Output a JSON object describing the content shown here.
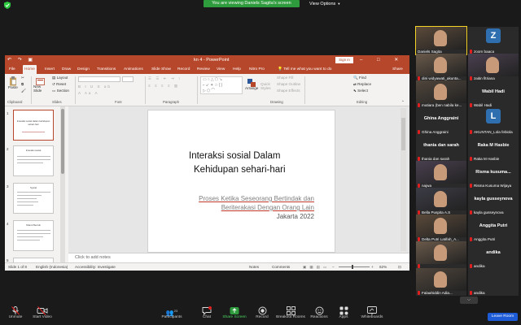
{
  "banner": {
    "viewing_text": "You are viewing Daniels Sagita's screen",
    "view_options": "View Options"
  },
  "powerpoint": {
    "file_title": "kn 4  -  PowerPoint",
    "sign_in": "Sign in",
    "quick_access": "↶ ↷ ▣",
    "window_controls": "– □ ✕",
    "tabs": [
      "File",
      "Home",
      "Insert",
      "Draw",
      "Design",
      "Transitions",
      "Animations",
      "Slide Show",
      "Record",
      "Review",
      "View",
      "Help",
      "Nitro Pro"
    ],
    "tell_me": "Tell me what you want to do",
    "share": "Share",
    "ribbon": {
      "paste": "Paste",
      "clipboard": "Clipboard",
      "new_slide": "New Slide",
      "layout": "Layout",
      "reset": "Reset",
      "section": "Section",
      "slides": "Slides",
      "font": "Font",
      "paragraph": "Paragraph",
      "arrange": "Arrange",
      "quick_styles": "Quick Styles",
      "shape_fill": "Shape Fill",
      "shape_outline": "Shape Outline",
      "shape_effects": "Shape Effects",
      "drawing": "Drawing",
      "find": "Find",
      "replace": "Replace",
      "select": "Select",
      "editing": "Editing"
    },
    "thumbnails": [
      {
        "num": "1",
        "title": "Interaksi sosial dalam kehidupan sehari-hari"
      },
      {
        "num": "2",
        "title": "Interaksi sosial"
      },
      {
        "num": "3",
        "title": "Syarat"
      },
      {
        "num": "4",
        "title": "Nilai & Bentuk"
      },
      {
        "num": "5",
        "title": ""
      }
    ],
    "slide": {
      "title_line1": "Interaksi sosial Dalam",
      "title_line2": "Kehidupan sehari-hari",
      "sub_line1": "Proses Ketika Seseorang Bertindak dan",
      "sub_line2": "Beriterakasi Dengan Orang Lain",
      "sub_line3": "Jakarta 2022"
    },
    "notes_placeholder": "Click to add notes",
    "status": {
      "slide_of": "Slide 1 of 8",
      "language": "English (Indonesia)",
      "accessibility": "Accessibility: Investigate",
      "notes": "Notes",
      "comments": "Comments",
      "zoom": "62%"
    }
  },
  "gallery": {
    "tiles": [
      {
        "name": "Daniels Sagita",
        "type": "video",
        "speaking": true
      },
      {
        "name": "zoom baaca",
        "type": "avatar",
        "letter": "Z",
        "color": "#2f6fb0"
      },
      {
        "name": "dini widyawati_akunta...",
        "type": "video"
      },
      {
        "name": "zaitin fitriana",
        "type": "video"
      },
      {
        "name": "mutiara (ben nabila ke...",
        "type": "video"
      },
      {
        "name": "Wabil Hadi",
        "type": "name",
        "big": "Wabil Hadi"
      },
      {
        "name": "Ghina Anggraini",
        "type": "name",
        "big": "Ghina Anggraini"
      },
      {
        "name": "AKUNTAN_Lola febiola",
        "type": "avatar",
        "letter": "L",
        "color": "#2f6fb0"
      },
      {
        "name": "thania dan sarah",
        "type": "name",
        "big": "thania dan sarah"
      },
      {
        "name": "Raka M Hasbie",
        "type": "name",
        "big": "Raka M Hasbie"
      },
      {
        "name": "najwa",
        "type": "video"
      },
      {
        "name": "Risma Kusuma Wijaya",
        "type": "name",
        "big": "Risma kusuma..."
      },
      {
        "name": "Bella Puspita A.S",
        "type": "video"
      },
      {
        "name": "kayla gusseynova",
        "type": "name",
        "big": "kayla gusseynova"
      },
      {
        "name": "Delta Putri Latifah_A...",
        "type": "video"
      },
      {
        "name": "Anggita Putri",
        "type": "name",
        "big": "Anggita Putri"
      },
      {
        "name": "",
        "type": "video"
      },
      {
        "name": "andika",
        "type": "name",
        "big": "andika"
      },
      {
        "name": "Falaahiddin Adia...",
        "type": "video"
      },
      {
        "name": "andika",
        "type": "name",
        "big": ""
      }
    ],
    "scroll_down": "⌵"
  },
  "toolbar": {
    "unmute": "Unmute",
    "start_video": "Start Video",
    "participants": "Participants",
    "participants_count": "23",
    "chat": "Chat",
    "share_screen": "Share Screen",
    "record": "Record",
    "breakout_rooms": "Breakout Rooms",
    "reactions": "Reactions",
    "apps": "Apps",
    "whiteboards": "Whiteboards",
    "leave": "Leave Room"
  },
  "colors": {
    "ppt_accent": "#b7472a",
    "zoom_green": "#2e9b3c",
    "leave_blue": "#1e5bd6",
    "speaker_outline": "#f5d327",
    "mic_muted": "#e02020"
  }
}
